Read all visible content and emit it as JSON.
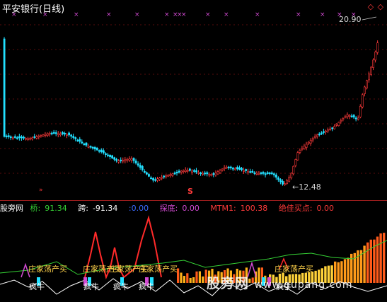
{
  "window": {
    "title": "平安银行(日线)",
    "top_icons": "◇ ◇"
  },
  "main_chart": {
    "high_label": "20.90",
    "low_label": "12.48",
    "low_arrow": "←",
    "signal_s": "S",
    "signal_arrow": "»",
    "bull_color": "#ff3a3a",
    "bear_color": "#22e0ff",
    "marker_color": "#d24bd2"
  },
  "indicator": {
    "name": "股旁网",
    "items": [
      {
        "label": "桥:",
        "value": "91.34",
        "color": "#35d235"
      },
      {
        "label": "跨:",
        "value": "-91.34",
        "color": "#ffffff"
      },
      {
        "label": "",
        "value": ":0.00",
        "color": "#3a6bff"
      },
      {
        "label": "探底:",
        "value": "0.00",
        "color": "#d24bd2"
      },
      {
        "label": "MTM1:",
        "value": "100.38",
        "color": "#ff3a3a"
      },
      {
        "label": "绝佳买点:",
        "value": "0.00",
        "color": "#ff3a3a"
      }
    ],
    "buy_signal_text": "庄家荡产买",
    "bull_text": "疯牛"
  },
  "watermark": {
    "text": "股旁网",
    "url": "www.gupang.com"
  }
}
